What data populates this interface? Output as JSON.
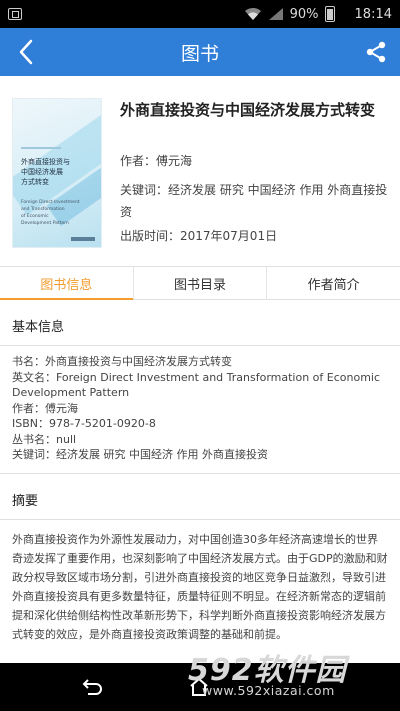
{
  "status_bar": {
    "battery": "90%",
    "time": "18:14"
  },
  "app_bar": {
    "title": "图书"
  },
  "book": {
    "cover": {
      "title_line1": "外商直接投资与",
      "title_line2": "中国经济发展",
      "title_line3": "方式转变",
      "en_line1": "Foreign Direct Investment",
      "en_line2": "and Transformation",
      "en_line3": "of Economic",
      "en_line4": "Development Pattern"
    },
    "title": "外商直接投资与中国经济发展方式转变",
    "author": "作者：傅元海",
    "keywords": "关键词：经济发展 研究 中国经济 作用 外商直接投资",
    "publish_date": "出版时间：2017年07月01日"
  },
  "tabs": [
    {
      "label": "图书信息",
      "active": true
    },
    {
      "label": "图书目录",
      "active": false
    },
    {
      "label": "作者简介",
      "active": false
    }
  ],
  "basic_info": {
    "heading": "基本信息",
    "rows": [
      "书名：外商直接投资与中国经济发展方式转变",
      "英文名：Foreign Direct Investment and Transformation of Economic Development Pattern",
      "作者：傅元海",
      "ISBN：978-7-5201-0920-8",
      "丛书名：null",
      "关键词：经济发展 研究 中国经济 作用 外商直接投资"
    ]
  },
  "summary": {
    "heading": "摘要",
    "text": "外商直接投资作为外源性发展动力，对中国创造30多年经济高速增长的世界奇迹发挥了重要作用，也深刻影响了中国经济发展方式。由于GDP的激励和财政分权导致区域市场分割，引进外商直接投资的地区竞争日益激烈，导致引进外商直接投资具有更多数量特征，质量特征则不明显。在经济新常态的逻辑前提和深化供给侧结构性改革新形势下，科学判断外商直接投资影响经济发展方式转变的效应，是外商直接投资政策调整的基础和前提。"
  },
  "watermark": {
    "logo": "592软件园",
    "url": "www.592xiazai.com"
  },
  "colors": {
    "app_bar": "#2f7ed8",
    "active_tab": "#f39c2f"
  }
}
